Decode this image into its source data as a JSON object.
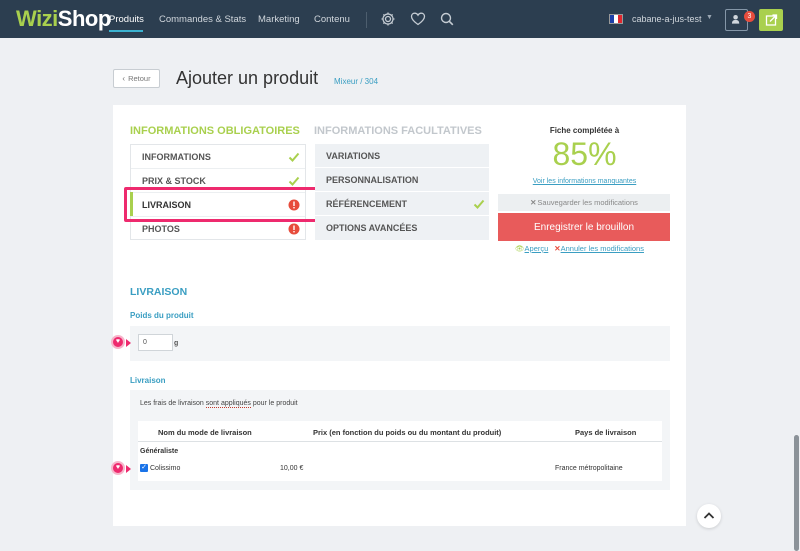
{
  "topbar": {
    "logo_part1": "Wizi",
    "logo_part2": "Shop",
    "nav": [
      "Produits",
      "Commandes & Stats",
      "Marketing",
      "Contenu"
    ],
    "shop_name": "cabane-a-jus-test",
    "notification_count": "3",
    "icons": [
      "gear-icon",
      "heart-icon",
      "search-icon",
      "user-icon",
      "external-link-icon"
    ],
    "colors": {
      "bar": "#2c3e50",
      "accent": "#a9d04e",
      "active_underline": "#3bb2d0"
    }
  },
  "header": {
    "back_label": "Retour",
    "title": "Ajouter un produit",
    "breadcrumb": "Mixeur / 304"
  },
  "tabs": {
    "mandatory_title": "INFORMATIONS OBLIGATOIRES",
    "optional_title": "INFORMATIONS FACULTATIVES",
    "mandatory": [
      {
        "label": "INFORMATIONS",
        "status": "ok"
      },
      {
        "label": "PRIX & STOCK",
        "status": "ok"
      },
      {
        "label": "LIVRAISON",
        "status": "error",
        "active": true
      },
      {
        "label": "PHOTOS",
        "status": "error"
      }
    ],
    "optional": [
      {
        "label": "VARIATIONS"
      },
      {
        "label": "PERSONNALISATION"
      },
      {
        "label": "RÉFÉRENCEMENT",
        "status": "ok"
      },
      {
        "label": "OPTIONS AVANCÉES"
      }
    ]
  },
  "completion": {
    "label": "Fiche complétée à",
    "percent": "85%",
    "missing_link": "Voir les informations manquantes",
    "save_label": "Sauvegarder les modifications",
    "draft_label": "Enregistrer le brouillon",
    "preview_label": "Aperçu",
    "cancel_label": "Annuler les modifications"
  },
  "livraison": {
    "title": "LIVRAISON",
    "weight_label": "Poids du produit",
    "weight_value": "0",
    "weight_unit": "g",
    "shipping_label": "Livraison",
    "info_pre": "Les frais de livraison ",
    "info_link": "sont appliqués",
    "info_post": " pour le produit",
    "columns": [
      "Nom du mode de livraison",
      "Prix (en fonction du poids ou du montant du produit)",
      "Pays de livraison"
    ],
    "group": "Généraliste",
    "rows": [
      {
        "name": "Colissimo",
        "price": "10,00 €",
        "country": "France métropolitaine",
        "checked": true
      }
    ]
  }
}
